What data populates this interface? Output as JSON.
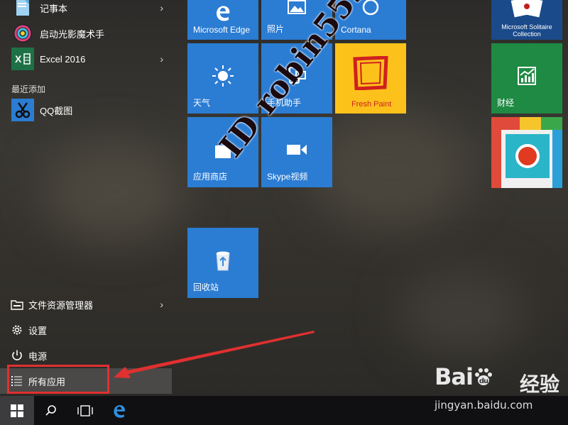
{
  "start_menu": {
    "apps": [
      {
        "label": "记事本",
        "icon": "notepad-icon",
        "has_submenu": true
      },
      {
        "label": "启动光影魔术手",
        "icon": "nikon-lens-icon",
        "has_submenu": false
      },
      {
        "label": "Excel 2016",
        "icon": "excel-icon",
        "has_submenu": true
      }
    ],
    "recent_section_label": "最近添加",
    "recent_apps": [
      {
        "label": "QQ截图",
        "icon": "scissors-icon"
      }
    ],
    "system_items": {
      "file_explorer": "文件资源管理器",
      "settings": "设置",
      "power": "电源",
      "all_apps": "所有应用"
    }
  },
  "tiles": {
    "edge": "Microsoft Edge",
    "photos": "照片",
    "cortana": "Cortana",
    "fresh_paint": "Fresh Paint",
    "solitaire": "Microsoft Solitaire Collection",
    "weather": "天气",
    "phone_companion": "手机助手",
    "finance": "财经",
    "store": "应用商店",
    "skype": "Skype视频",
    "recycle_bin": "回收站"
  },
  "watermark": {
    "text": "ID robin553"
  },
  "baidu_logo": {
    "brand": "Bai",
    "brand2": "du",
    "suffix": "经验",
    "url": "jingyan.baidu.com"
  },
  "colors": {
    "tile_blue": "#2b7cd3",
    "tile_green": "#1e8a43",
    "fresh_paint_yellow": "#fcc21b",
    "annotation_red": "#e03030",
    "taskbar": "#101012"
  }
}
